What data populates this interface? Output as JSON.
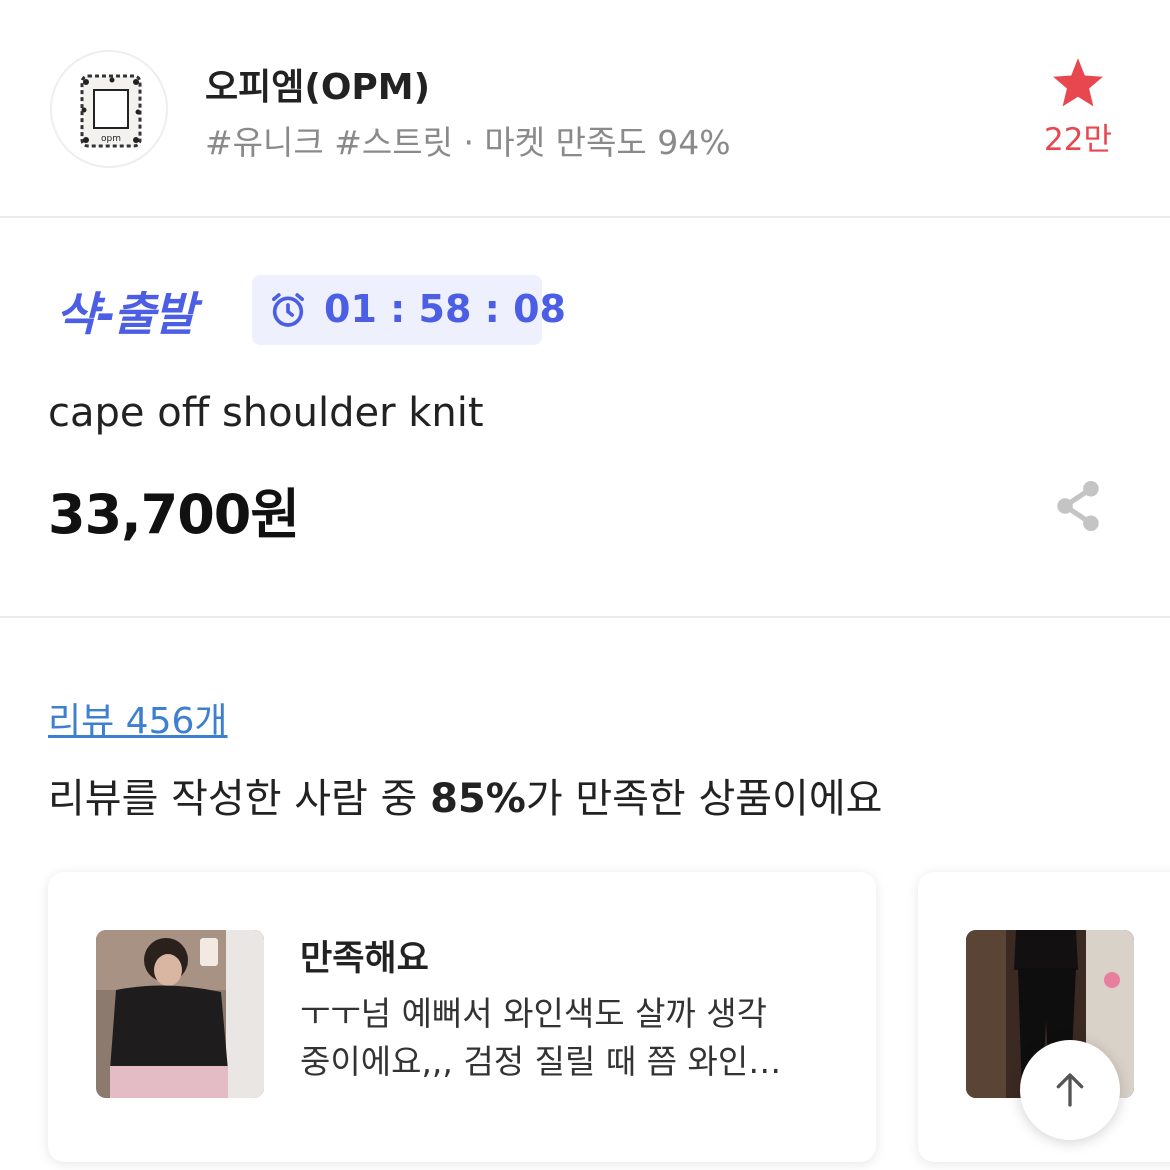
{
  "store": {
    "name": "오피엠(OPM)",
    "meta": "#유니크 #스트릿 · 마켓 만족도 94%",
    "favorite_count": "22만",
    "logo_text": "opm"
  },
  "product": {
    "badge": "샥-출발",
    "timer": "01 : 58 : 08",
    "name": "cape off shoulder knit",
    "price": "33,700원"
  },
  "reviews": {
    "link": "리뷰 456개",
    "summary_prefix": "리뷰를 작성한 사람 중 ",
    "summary_percent": "85%",
    "summary_suffix": "가 만족한 상품이에요",
    "cards": [
      {
        "title": "만족해요",
        "line1": "ㅜㅜ넘 예뻐서 와인색도 살까 생각",
        "line2": "중이에요,,, 검정 질릴 때 쯤 와인…"
      }
    ]
  },
  "colors": {
    "accent_blue": "#4b5ee4",
    "link_blue": "#3e7fd0",
    "favorite_red": "#e8474f"
  },
  "icons": [
    "store-logo",
    "star-icon",
    "alarm-clock-icon",
    "share-icon",
    "arrow-up-icon"
  ]
}
